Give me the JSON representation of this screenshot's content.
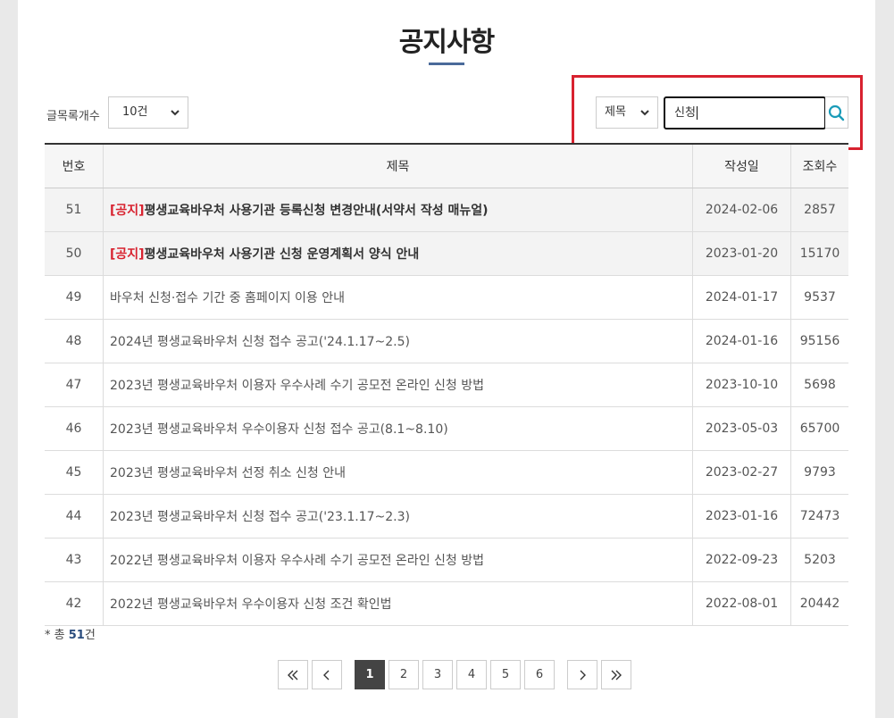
{
  "page": {
    "title": "공지사항"
  },
  "controls": {
    "list_count_label": "글목록개수",
    "list_count_value": "10건",
    "search_field_value": "제목",
    "search_query": "신청"
  },
  "table": {
    "headers": [
      "번호",
      "제목",
      "작성일",
      "조회수"
    ],
    "rows": [
      {
        "num": "51",
        "tag": "[공지]",
        "title": "평생교육바우처 사용기관 등록신청 변경안내(서약서 작성 매뉴얼)",
        "date": "2024-02-06",
        "views": "2857",
        "notice": true
      },
      {
        "num": "50",
        "tag": "[공지]",
        "title": "평생교육바우처 사용기관 신청 운영계획서 양식 안내",
        "date": "2023-01-20",
        "views": "15170",
        "notice": true
      },
      {
        "num": "49",
        "tag": "",
        "title": "바우처 신청·접수 기간 중 홈페이지 이용 안내",
        "date": "2024-01-17",
        "views": "9537",
        "notice": false
      },
      {
        "num": "48",
        "tag": "",
        "title": "2024년 평생교육바우처 신청 접수 공고('24.1.17~2.5)",
        "date": "2024-01-16",
        "views": "95156",
        "notice": false
      },
      {
        "num": "47",
        "tag": "",
        "title": "2023년 평생교육바우처 이용자 우수사례 수기 공모전 온라인 신청 방법",
        "date": "2023-10-10",
        "views": "5698",
        "notice": false
      },
      {
        "num": "46",
        "tag": "",
        "title": "2023년 평생교육바우처 우수이용자 신청 접수 공고(8.1~8.10)",
        "date": "2023-05-03",
        "views": "65700",
        "notice": false
      },
      {
        "num": "45",
        "tag": "",
        "title": "2023년 평생교육바우처 선정 취소 신청 안내",
        "date": "2023-02-27",
        "views": "9793",
        "notice": false
      },
      {
        "num": "44",
        "tag": "",
        "title": "2023년 평생교육바우처 신청 접수 공고('23.1.17~2.3)",
        "date": "2023-01-16",
        "views": "72473",
        "notice": false
      },
      {
        "num": "43",
        "tag": "",
        "title": "2022년 평생교육바우처 이용자 우수사례 수기 공모전 온라인 신청 방법",
        "date": "2022-09-23",
        "views": "5203",
        "notice": false
      },
      {
        "num": "42",
        "tag": "",
        "title": "2022년 평생교육바우처 우수이용자 신청 조건 확인법",
        "date": "2022-08-01",
        "views": "20442",
        "notice": false
      }
    ]
  },
  "summary": {
    "prefix": "* 총 ",
    "count": "51",
    "suffix": "건"
  },
  "pagination": {
    "first": "«",
    "prev": "‹",
    "pages": [
      "1",
      "2",
      "3",
      "4",
      "5",
      "6"
    ],
    "current": "1",
    "next": "›",
    "last": "»"
  },
  "icons": {
    "search": "search-icon",
    "dropdown": "chevron-down-icon"
  },
  "colors": {
    "highlight": "#d8222f",
    "notice_tag": "#d8222f",
    "accent": "#2b4d7e",
    "active_page": "#444444"
  }
}
